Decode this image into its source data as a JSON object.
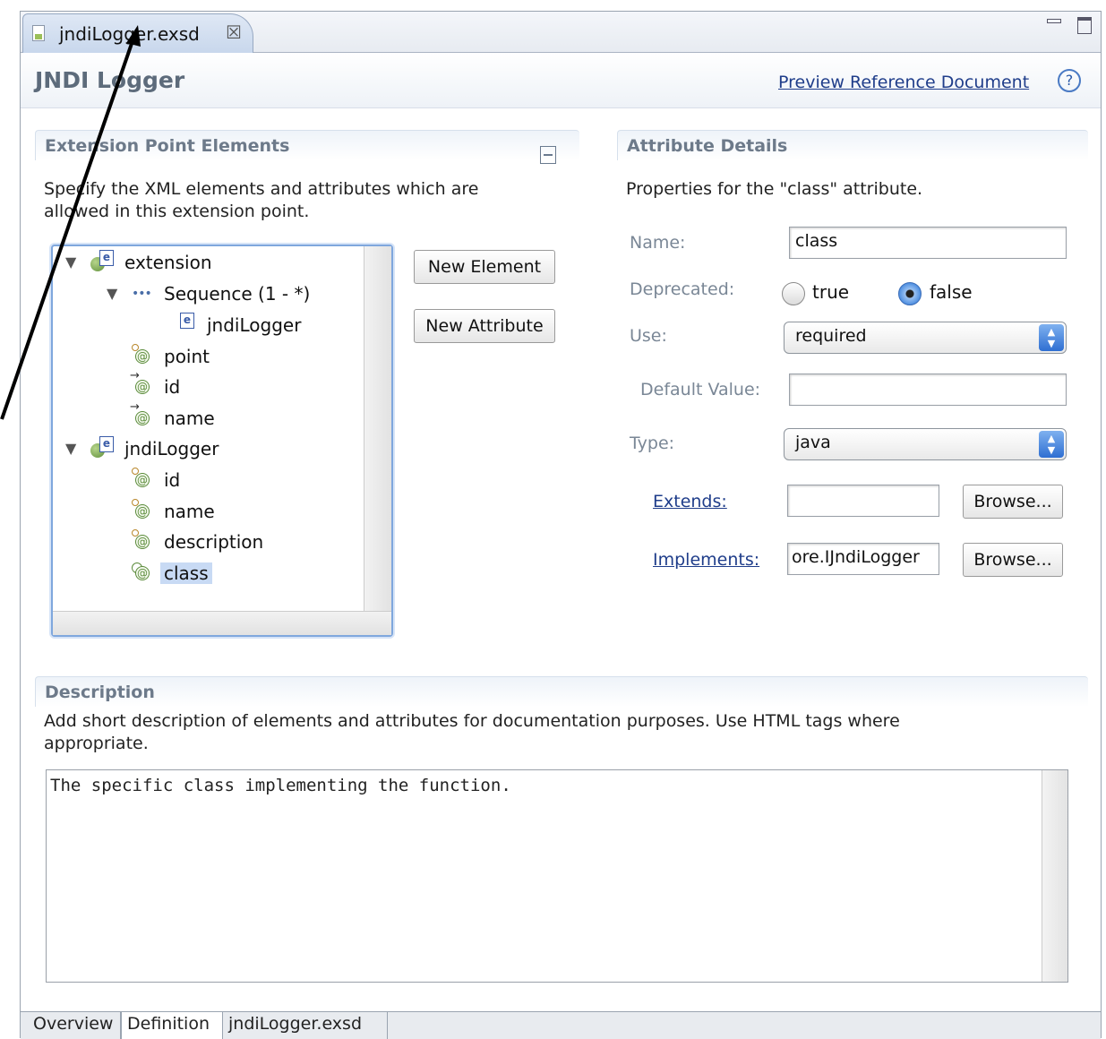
{
  "editor_tab": {
    "label": "jndiLogger.exsd",
    "close": "☒"
  },
  "header": {
    "title": "JNDI Logger",
    "preview_link": "Preview Reference Document",
    "help": "?"
  },
  "left_section": {
    "title": "Extension Point Elements",
    "description_line1": "Specify the XML elements and attributes which are",
    "description_line2": "allowed in this extension point.",
    "tree": [
      {
        "label": "extension",
        "kind": "element",
        "expanded": true
      },
      {
        "label": "Sequence (1 - *)",
        "kind": "sequence",
        "expanded": true
      },
      {
        "label": "jndiLogger",
        "kind": "element-ref"
      },
      {
        "label": "point",
        "kind": "attribute"
      },
      {
        "label": "id",
        "kind": "attribute-ref"
      },
      {
        "label": "name",
        "kind": "attribute-ref"
      },
      {
        "label": "jndiLogger",
        "kind": "element",
        "expanded": true
      },
      {
        "label": "id",
        "kind": "attribute"
      },
      {
        "label": "name",
        "kind": "attribute"
      },
      {
        "label": "description",
        "kind": "attribute"
      },
      {
        "label": "class",
        "kind": "attribute",
        "selected": true
      }
    ],
    "new_element_button": "New Element",
    "new_attribute_button": "New Attribute"
  },
  "right_section": {
    "title": "Attribute Details",
    "description": "Properties for the \"class\" attribute.",
    "name_label": "Name:",
    "name_value": "class",
    "deprecated_label": "Deprecated:",
    "deprecated_true": "true",
    "deprecated_false": "false",
    "deprecated_selected": "false",
    "use_label": "Use:",
    "use_value": "required",
    "default_label": "Default Value:",
    "default_value": "",
    "type_label": "Type:",
    "type_value": "java",
    "extends_label": "Extends:",
    "extends_value": "",
    "implements_label": "Implements:",
    "implements_value": "ore.IJndiLogger",
    "browse": "Browse..."
  },
  "description_section": {
    "title": "Description",
    "hint_line1": "Add short description of elements and attributes for documentation purposes. Use HTML tags where",
    "hint_line2": "appropriate.",
    "text": "The specific class implementing the function."
  },
  "bottom_tabs": [
    "Overview",
    "Definition",
    "jndiLogger.exsd"
  ],
  "active_bottom_tab": "Definition",
  "colors": {
    "link": "#1f3d8a",
    "section_title": "#6d7a8a",
    "selection": "#c8daf4"
  }
}
